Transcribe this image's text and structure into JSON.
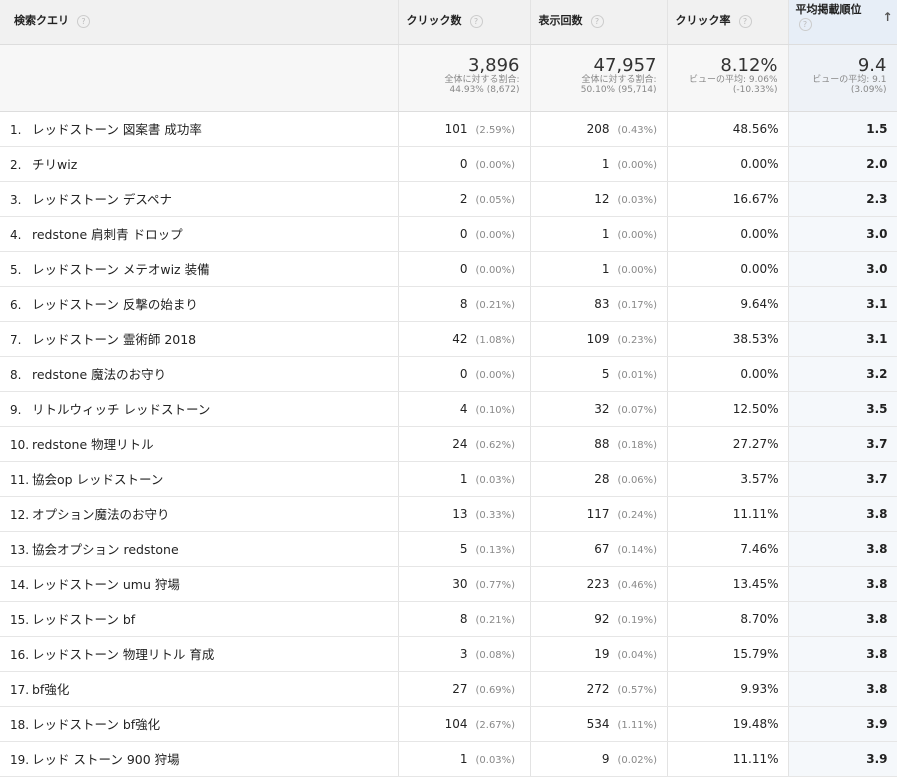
{
  "header": {
    "query": "検索クエリ",
    "clicks": "クリック数",
    "impressions": "表示回数",
    "ctr": "クリック率",
    "position": "平均掲載順位",
    "help_glyph": "?",
    "sort_glyph": "↑"
  },
  "totals": {
    "clicks": {
      "value": "3,896",
      "line1": "全体に対する割合:",
      "line2": "44.93% (8,672)"
    },
    "impressions": {
      "value": "47,957",
      "line1": "全体に対する割合:",
      "line2": "50.10% (95,714)"
    },
    "ctr": {
      "value": "8.12%",
      "line1": "ビューの平均: 9.06%",
      "line2": "(-10.33%)"
    },
    "position": {
      "value": "9.4",
      "line1": "ビューの平均: 9.1",
      "line2": "(3.09%)"
    }
  },
  "rows": [
    {
      "n": "1.",
      "q": "レッドストーン 図案書 成功率",
      "c": "101",
      "cp": "(2.59%)",
      "i": "208",
      "ip": "(0.43%)",
      "ctr": "48.56%",
      "pos": "1.5"
    },
    {
      "n": "2.",
      "q": "チリwiz",
      "c": "0",
      "cp": "(0.00%)",
      "i": "1",
      "ip": "(0.00%)",
      "ctr": "0.00%",
      "pos": "2.0"
    },
    {
      "n": "3.",
      "q": "レッドストーン デスペナ",
      "c": "2",
      "cp": "(0.05%)",
      "i": "12",
      "ip": "(0.03%)",
      "ctr": "16.67%",
      "pos": "2.3"
    },
    {
      "n": "4.",
      "q": "redstone 肩刺青 ドロップ",
      "c": "0",
      "cp": "(0.00%)",
      "i": "1",
      "ip": "(0.00%)",
      "ctr": "0.00%",
      "pos": "3.0"
    },
    {
      "n": "5.",
      "q": "レッドストーン メテオwiz 装備",
      "c": "0",
      "cp": "(0.00%)",
      "i": "1",
      "ip": "(0.00%)",
      "ctr": "0.00%",
      "pos": "3.0"
    },
    {
      "n": "6.",
      "q": "レッドストーン 反撃の始まり",
      "c": "8",
      "cp": "(0.21%)",
      "i": "83",
      "ip": "(0.17%)",
      "ctr": "9.64%",
      "pos": "3.1"
    },
    {
      "n": "7.",
      "q": "レッドストーン 霊術師 2018",
      "c": "42",
      "cp": "(1.08%)",
      "i": "109",
      "ip": "(0.23%)",
      "ctr": "38.53%",
      "pos": "3.1"
    },
    {
      "n": "8.",
      "q": "redstone 魔法のお守り",
      "c": "0",
      "cp": "(0.00%)",
      "i": "5",
      "ip": "(0.01%)",
      "ctr": "0.00%",
      "pos": "3.2"
    },
    {
      "n": "9.",
      "q": "リトルウィッチ レッドストーン",
      "c": "4",
      "cp": "(0.10%)",
      "i": "32",
      "ip": "(0.07%)",
      "ctr": "12.50%",
      "pos": "3.5"
    },
    {
      "n": "10.",
      "q": "redstone 物理リトル",
      "c": "24",
      "cp": "(0.62%)",
      "i": "88",
      "ip": "(0.18%)",
      "ctr": "27.27%",
      "pos": "3.7"
    },
    {
      "n": "11.",
      "q": "協会op レッドストーン",
      "c": "1",
      "cp": "(0.03%)",
      "i": "28",
      "ip": "(0.06%)",
      "ctr": "3.57%",
      "pos": "3.7"
    },
    {
      "n": "12.",
      "q": "オプション魔法のお守り",
      "c": "13",
      "cp": "(0.33%)",
      "i": "117",
      "ip": "(0.24%)",
      "ctr": "11.11%",
      "pos": "3.8"
    },
    {
      "n": "13.",
      "q": "協会オプション redstone",
      "c": "5",
      "cp": "(0.13%)",
      "i": "67",
      "ip": "(0.14%)",
      "ctr": "7.46%",
      "pos": "3.8"
    },
    {
      "n": "14.",
      "q": "レッドストーン umu 狩場",
      "c": "30",
      "cp": "(0.77%)",
      "i": "223",
      "ip": "(0.46%)",
      "ctr": "13.45%",
      "pos": "3.8"
    },
    {
      "n": "15.",
      "q": "レッドストーン bf",
      "c": "8",
      "cp": "(0.21%)",
      "i": "92",
      "ip": "(0.19%)",
      "ctr": "8.70%",
      "pos": "3.8"
    },
    {
      "n": "16.",
      "q": "レッドストーン 物理リトル 育成",
      "c": "3",
      "cp": "(0.08%)",
      "i": "19",
      "ip": "(0.04%)",
      "ctr": "15.79%",
      "pos": "3.8"
    },
    {
      "n": "17.",
      "q": "bf強化",
      "c": "27",
      "cp": "(0.69%)",
      "i": "272",
      "ip": "(0.57%)",
      "ctr": "9.93%",
      "pos": "3.8"
    },
    {
      "n": "18.",
      "q": "レッドストーン bf強化",
      "c": "104",
      "cp": "(2.67%)",
      "i": "534",
      "ip": "(1.11%)",
      "ctr": "19.48%",
      "pos": "3.9"
    },
    {
      "n": "19.",
      "q": "レッド ストーン 900 狩場",
      "c": "1",
      "cp": "(0.03%)",
      "i": "9",
      "ip": "(0.02%)",
      "ctr": "11.11%",
      "pos": "3.9"
    }
  ]
}
